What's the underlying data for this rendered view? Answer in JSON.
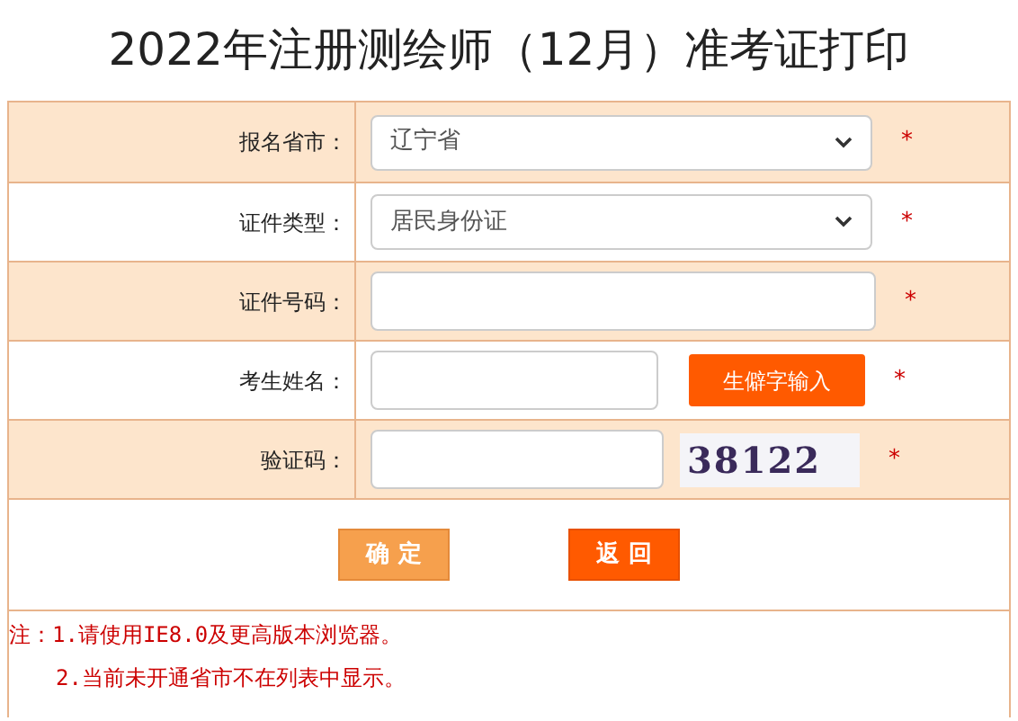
{
  "title": "2022年注册测绘师（12月）准考证打印",
  "rows": [
    {
      "kind": "select",
      "label": "报名省市：",
      "value": "辽宁省",
      "required_mark": "*"
    },
    {
      "kind": "select",
      "label": "证件类型：",
      "value": "居民身份证",
      "required_mark": "*"
    },
    {
      "kind": "input",
      "label": "证件号码：",
      "required_mark": "*"
    },
    {
      "kind": "input_button",
      "label": "考生姓名：",
      "button": "生僻字输入",
      "required_mark": "*"
    },
    {
      "kind": "captcha",
      "label": "验证码：",
      "captcha": "38122",
      "required_mark": "*"
    }
  ],
  "buttons": [
    {
      "label": "确 定",
      "kind": "confirm"
    },
    {
      "label": "返 回",
      "kind": "back"
    }
  ],
  "notes": [
    "注：1.请使用IE8.0及更高版本浏览器。",
    "2.当前未开通省市不在列表中显示。"
  ]
}
